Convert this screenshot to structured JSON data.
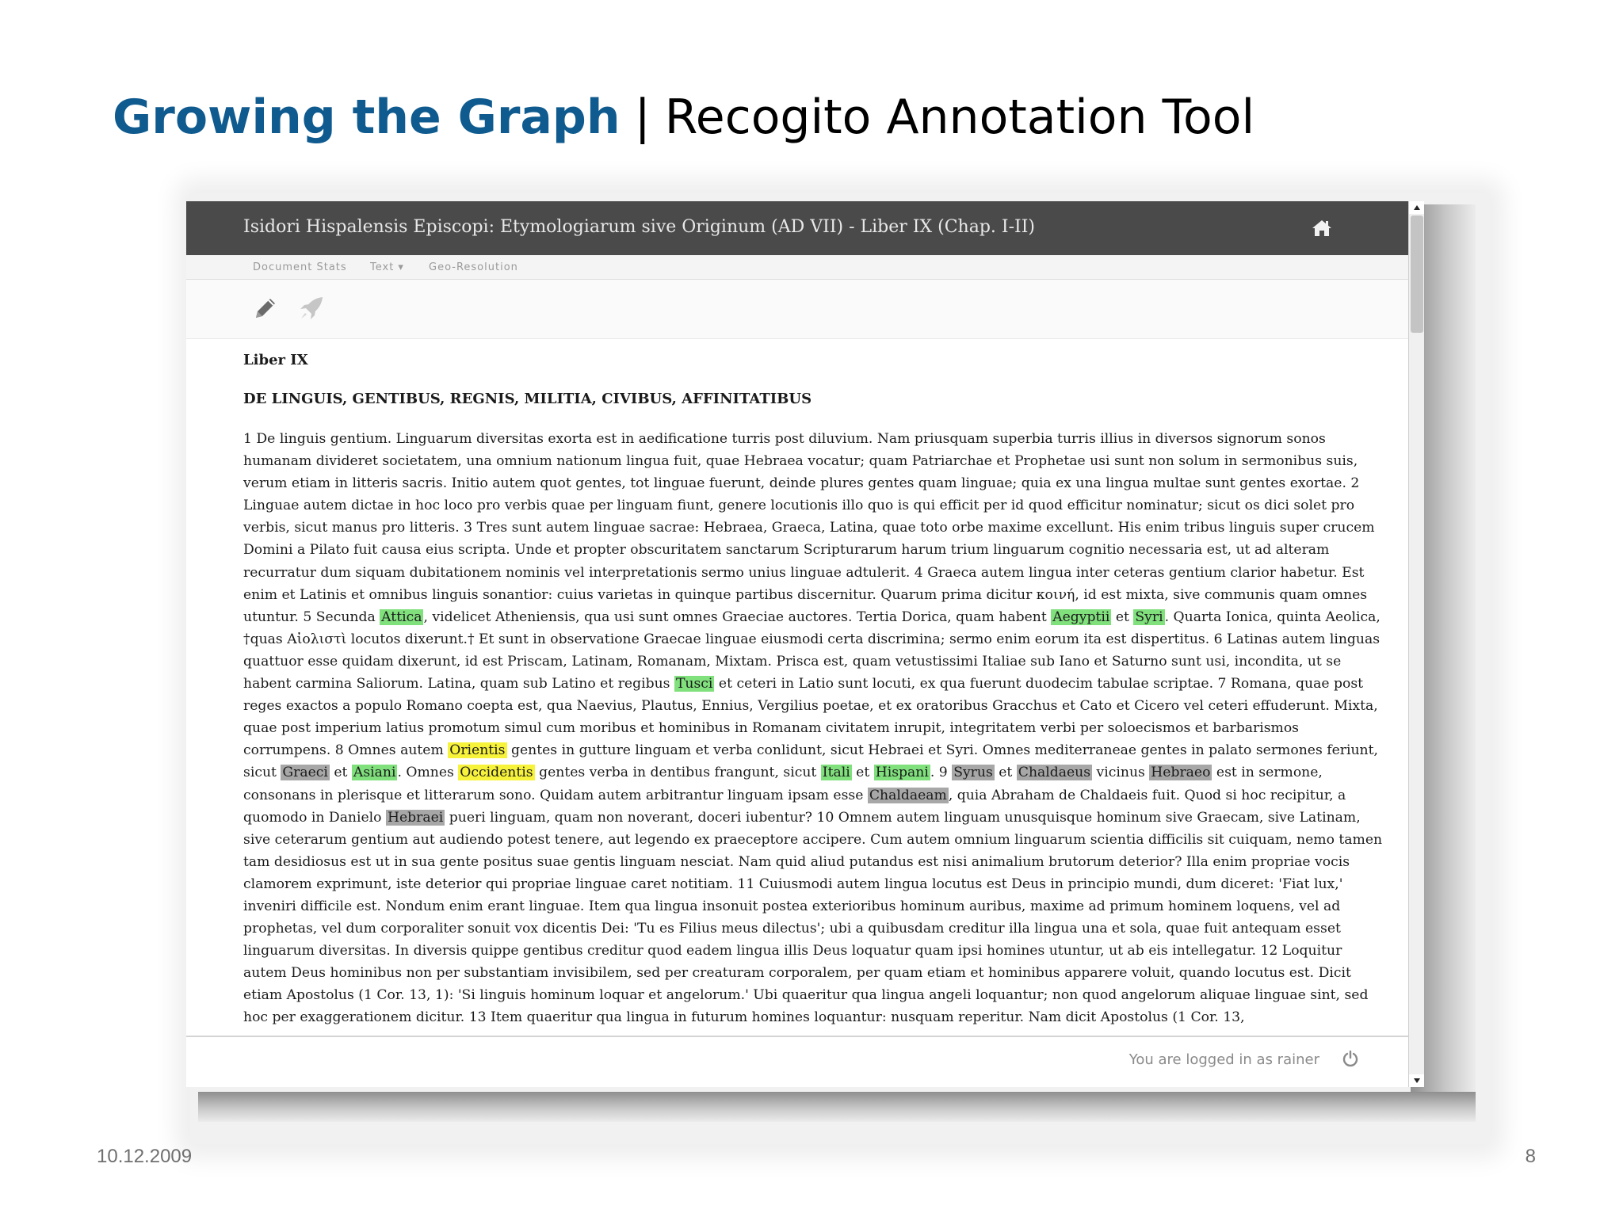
{
  "slide": {
    "title_strong": "Growing the Graph",
    "title_sep": "|",
    "title_rest": "Recogito Annotation Tool",
    "date": "10.12.2009",
    "page_number": "8"
  },
  "app": {
    "document_title": "Isidori Hispalensis Episcopi: Etymologiarum sive Originum (AD VII) - Liber IX (Chap. I-II)",
    "home_icon": "home-icon",
    "menu": [
      "Document Stats",
      "Text ▾",
      "Geo-Resolution"
    ],
    "tools": [
      "pencil-icon",
      "rocket-icon"
    ],
    "status": "You are logged in as rainer",
    "logout_icon": "power-icon"
  },
  "colors": {
    "title_blue": "#0f5a8e",
    "titlebar": "#4a4a4a",
    "highlight_green": "#7fe07c",
    "highlight_yellow": "#f7f23a",
    "highlight_grey": "#a7a7a7"
  },
  "text": {
    "liber": "Liber IX",
    "heading": "DE LINGUIS, GENTIBUS, REGNIS, MILITIA, CIVIBUS, AFFINITATIBUS",
    "segments": [
      {
        "t": "1 De linguis gentium. Linguarum diversitas exorta est in aedificatione turris post diluvium. Nam priusquam superbia turris illius in diversos signorum sonos humanam divideret societatem, una omnium nationum lingua fuit, quae Hebraea vocatur; quam Patriarchae et Prophetae usi sunt non solum in sermonibus suis, verum etiam in litteris sacris. Initio autem quot gentes, tot linguae fuerunt, deinde plures gentes quam linguae; quia ex una lingua multae sunt gentes exortae. 2 Linguae autem dictae in hoc loco pro verbis quae per linguam fiunt, genere locutionis illo quo is qui efficit per id quod efficitur nominatur; sicut os dici solet pro verbis, sicut manus pro litteris. 3 Tres sunt autem linguae sacrae: Hebraea, Graeca, Latina, quae toto orbe maxime excellunt. His enim tribus linguis super crucem Domini a Pilato fuit causa eius scripta. Unde et propter obscuritatem sanctarum Scripturarum harum trium linguarum cognitio necessaria est, ut ad alteram recurratur dum siquam dubitationem nominis vel interpretationis sermo unius linguae adtulerit. 4 Graeca autem lingua inter ceteras gentium clarior habetur. Est enim et Latinis et omnibus linguis sonantior: cuius varietas in quinque partibus discernitur. Quarum prima dicitur κοινή, id est mixta, sive communis quam omnes utuntur. 5 Secunda ",
        "h": ""
      },
      {
        "t": "Attica",
        "h": "green"
      },
      {
        "t": ", videlicet Atheniensis, qua usi sunt omnes Graeciae auctores. Tertia Dorica, quam habent ",
        "h": ""
      },
      {
        "t": "Aegyptii",
        "h": "green"
      },
      {
        "t": " et ",
        "h": ""
      },
      {
        "t": "Syri",
        "h": "green"
      },
      {
        "t": ". Quarta Ionica, quinta Aeolica, †quas Αἰολιστὶ locutos dixerunt.† Et sunt in observatione Graecae linguae eiusmodi certa discrimina; sermo enim eorum ita est dispertitus. 6 Latinas autem linguas quattuor esse quidam dixerunt, id est Priscam, Latinam, Romanam, Mixtam. Prisca est, quam vetustissimi Italiae sub Iano et Saturno sunt usi, incondita, ut se habent carmina Saliorum. Latina, quam sub Latino et regibus ",
        "h": ""
      },
      {
        "t": "Tusci",
        "h": "green"
      },
      {
        "t": " et ceteri in Latio sunt locuti, ex qua fuerunt duodecim tabulae scriptae. 7 Romana, quae post reges exactos a populo Romano coepta est, qua Naevius, Plautus, Ennius, Vergilius poetae, et ex oratoribus Gracchus et Cato et Cicero vel ceteri effuderunt. Mixta, quae post imperium latius promotum simul cum moribus et hominibus in Romanam civitatem inrupit, integritatem verbi per soloecismos et barbarismos corrumpens. 8 Omnes autem ",
        "h": ""
      },
      {
        "t": "Orientis",
        "h": "yellow"
      },
      {
        "t": " gentes in gutture linguam et verba conlidunt, sicut Hebraei et Syri. Omnes mediterraneae gentes in palato sermones feriunt, sicut ",
        "h": ""
      },
      {
        "t": "Graeci",
        "h": "grey"
      },
      {
        "t": " et ",
        "h": ""
      },
      {
        "t": "Asiani",
        "h": "green"
      },
      {
        "t": ". Omnes ",
        "h": ""
      },
      {
        "t": "Occidentis",
        "h": "yellow"
      },
      {
        "t": " gentes verba in dentibus frangunt, sicut ",
        "h": ""
      },
      {
        "t": "Itali",
        "h": "green"
      },
      {
        "t": " et ",
        "h": ""
      },
      {
        "t": "Hispani",
        "h": "green"
      },
      {
        "t": ". 9 ",
        "h": ""
      },
      {
        "t": "Syrus",
        "h": "grey"
      },
      {
        "t": " et ",
        "h": ""
      },
      {
        "t": "Chaldaeus",
        "h": "grey"
      },
      {
        "t": " vicinus ",
        "h": ""
      },
      {
        "t": "Hebraeo",
        "h": "grey"
      },
      {
        "t": " est in sermone, consonans in plerisque et litterarum sono. Quidam autem arbitrantur linguam ipsam esse ",
        "h": ""
      },
      {
        "t": "Chaldaeam",
        "h": "grey"
      },
      {
        "t": ", quia Abraham de Chaldaeis fuit. Quod si hoc recipitur, a quomodo in Danielo ",
        "h": ""
      },
      {
        "t": "Hebraei",
        "h": "grey"
      },
      {
        "t": " pueri linguam, quam non noverant, doceri iubentur? 10 Omnem autem linguam unusquisque hominum sive Graecam, sive Latinam, sive ceterarum gentium aut audiendo potest tenere, aut legendo ex praeceptore accipere. Cum autem omnium linguarum scientia difficilis sit cuiquam, nemo tamen tam desidiosus est ut in sua gente positus suae gentis linguam nesciat. Nam quid aliud putandus est nisi animalium brutorum deterior? Illa enim propriae vocis clamorem exprimunt, iste deterior qui propriae linguae caret notitiam. 11 Cuiusmodi autem lingua locutus est Deus in principio mundi, dum diceret: 'Fiat lux,' inveniri difficile est. Nondum enim erant linguae. Item qua lingua insonuit postea exterioribus hominum auribus, maxime ad primum hominem loquens, vel ad prophetas, vel dum corporaliter sonuit vox dicentis Dei: 'Tu es Filius meus dilectus'; ubi a quibusdam creditur illa lingua una et sola, quae fuit antequam esset linguarum diversitas. In diversis quippe gentibus creditur quod eadem lingua illis Deus loquatur quam ipsi homines utuntur, ut ab eis intellegatur. 12 Loquitur autem Deus hominibus non per substantiam invisibilem, sed per creaturam corporalem, per quam etiam et hominibus apparere voluit, quando locutus est. Dicit etiam Apostolus (1 Cor. 13, 1): 'Si linguis hominum loquar et angelorum.' Ubi quaeritur qua lingua angeli loquantur; non quod angelorum aliquae linguae sint, sed hoc per exaggerationem dicitur. 13 Item quaeritur qua lingua in futurum homines loquantur: nusquam reperitur. Nam dicit Apostolus (1 Cor. 13,",
        "h": ""
      }
    ]
  }
}
